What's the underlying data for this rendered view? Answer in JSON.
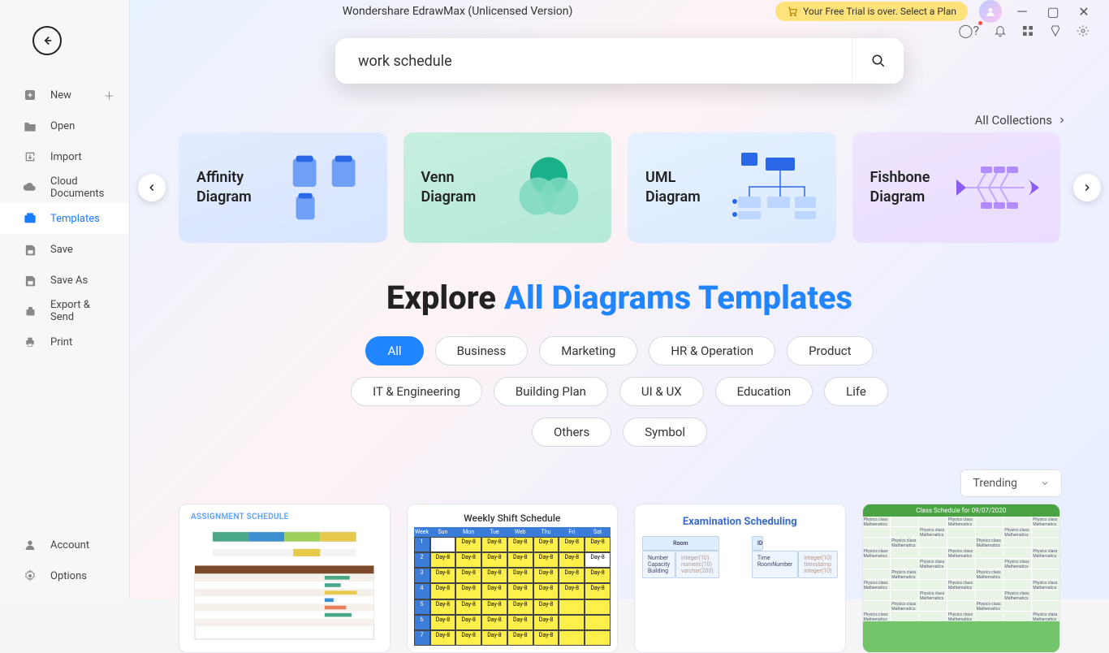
{
  "app": {
    "title": "Wondershare EdrawMax (Unlicensed Version)"
  },
  "trial": {
    "label": "Your Free Trial is over. Select a Plan"
  },
  "sidebar": {
    "items": [
      {
        "label": "New"
      },
      {
        "label": "Open"
      },
      {
        "label": "Import"
      },
      {
        "label": "Cloud Documents"
      },
      {
        "label": "Templates"
      },
      {
        "label": "Save"
      },
      {
        "label": "Save As"
      },
      {
        "label": "Export & Send"
      },
      {
        "label": "Print"
      }
    ],
    "footer": [
      {
        "label": "Account"
      },
      {
        "label": "Options"
      }
    ]
  },
  "search": {
    "value": "work schedule"
  },
  "collections": {
    "label": "All Collections"
  },
  "categories": [
    {
      "label": "Affinity Diagram"
    },
    {
      "label": "Venn Diagram"
    },
    {
      "label": "UML Diagram"
    },
    {
      "label": "Fishbone Diagram"
    }
  ],
  "heading": {
    "pre": "Explore ",
    "accent": "All Diagrams Templates"
  },
  "filters": [
    "All",
    "Business",
    "Marketing",
    "HR & Operation",
    "Product",
    "IT & Engineering",
    "Building Plan",
    "UI & UX",
    "Education",
    "Life",
    "Others",
    "Symbol"
  ],
  "sort": {
    "value": "Trending"
  },
  "templates": {
    "t1": {
      "title": "ASSIGNMENT SCHEDULE"
    },
    "t2": {
      "title": "Weekly Shift Schedule",
      "cols": [
        "Week",
        "Sun",
        "Mon",
        "Tue",
        "Web",
        "Thu",
        "Fri",
        "Sat"
      ],
      "cell": "Day-8",
      "rows": [
        "1",
        "2",
        "3",
        "4",
        "5",
        "6",
        "7"
      ]
    },
    "t3": {
      "title": "Examination Scheduling",
      "box_room": "Room",
      "box_room_lines": "Number\nCapacity\nBuilding",
      "box_time": "Time\nRoomNumber",
      "int1": "integer(10)\nnumeric(10)\nvarchar(200)",
      "int2": "integer(10)\ntimestamp\ninteger(10)"
    },
    "t4": {
      "title": "Class Schedule for 09/07/2020"
    }
  }
}
